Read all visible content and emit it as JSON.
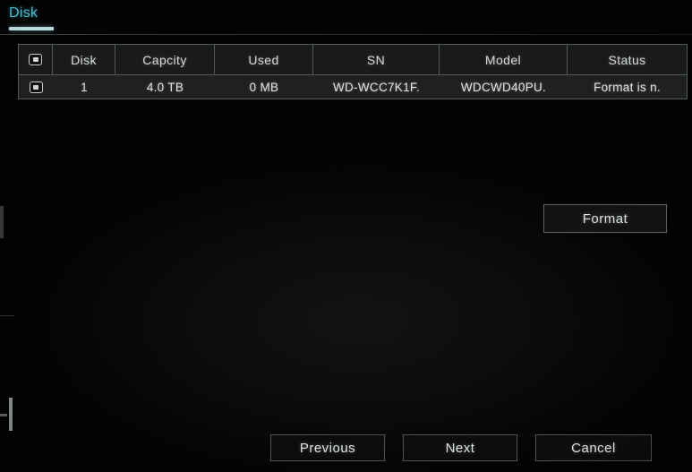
{
  "window": {
    "background_color": "#000000",
    "accent_color": "#45c3d6",
    "border_color": "#4f5b5d",
    "text_color": "#d9dcdd"
  },
  "tabs": [
    {
      "id": "disk",
      "label": "Disk",
      "active": true
    }
  ],
  "disk_table": {
    "columns": [
      {
        "key": "select",
        "label": ""
      },
      {
        "key": "disk",
        "label": "Disk"
      },
      {
        "key": "capacity",
        "label": "Capcity"
      },
      {
        "key": "used",
        "label": "Used"
      },
      {
        "key": "sn",
        "label": "SN"
      },
      {
        "key": "model",
        "label": "Model"
      },
      {
        "key": "status",
        "label": "Status"
      }
    ],
    "header_select_checkbox": {
      "icon": "checkbox-icon",
      "checked": false
    },
    "rows": [
      {
        "select": {
          "icon": "checkbox-icon",
          "checked": false
        },
        "disk": "1",
        "capacity": "4.0 TB",
        "used": "0 MB",
        "sn": "WD-WCC7K1F.",
        "model": "WDCWD40PU.",
        "status": "Format is n."
      }
    ]
  },
  "actions": {
    "format_label": "Format"
  },
  "footer": {
    "previous_label": "Previous",
    "next_label": "Next",
    "cancel_label": "Cancel"
  }
}
